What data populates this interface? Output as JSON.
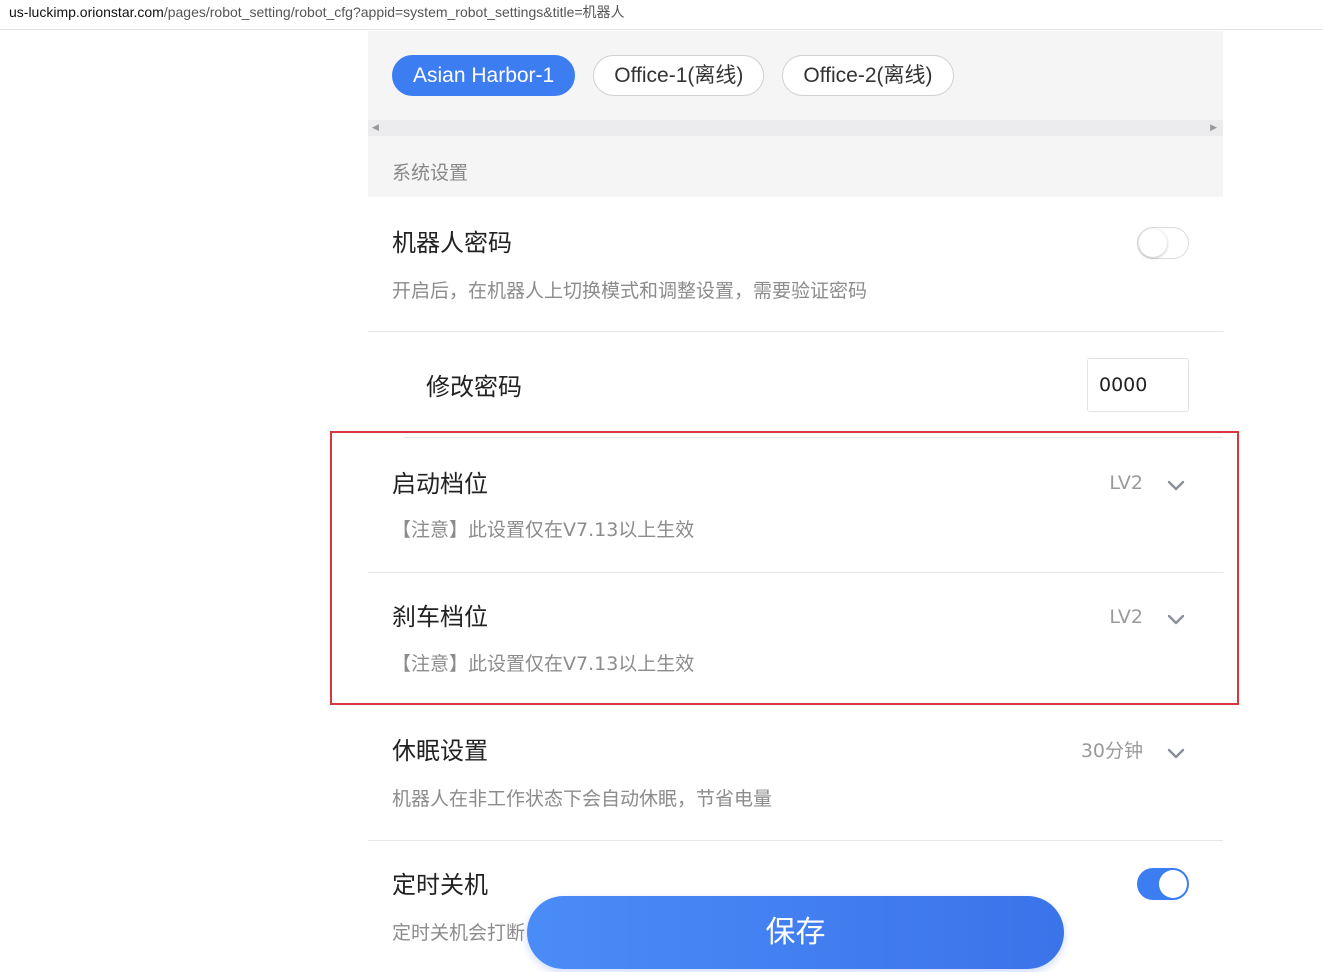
{
  "browser": {
    "url_host": "us-luckimp.orionstar.com",
    "url_path": "/pages/robot_setting/robot_cfg?appid=system_robot_settings&title=机器人"
  },
  "tabs": [
    {
      "label": "Asian Harbor-1",
      "active": true
    },
    {
      "label": "Office-1(离线)",
      "active": false
    },
    {
      "label": "Office-2(离线)",
      "active": false
    }
  ],
  "section_title": "系统设置",
  "settings": {
    "robot_password": {
      "title": "机器人密码",
      "desc": "开启后，在机器人上切换模式和调整设置，需要验证密码",
      "enabled": false
    },
    "change_password": {
      "title": "修改密码",
      "value": "0000"
    },
    "start_level": {
      "title": "启动档位",
      "desc": "【注意】此设置仅在V7.13以上生效",
      "value": "LV2"
    },
    "brake_level": {
      "title": "刹车档位",
      "desc": "【注意】此设置仅在V7.13以上生效",
      "value": "LV2"
    },
    "sleep": {
      "title": "休眠设置",
      "desc": "机器人在非工作状态下会自动休眠，节省电量",
      "value": "30分钟"
    },
    "timed_shutdown": {
      "title": "定时关机",
      "desc": "定时关机会打断",
      "enabled": true
    }
  },
  "save_label": "保存",
  "colors": {
    "accent": "#3d7df2",
    "highlight_border": "#d9363e"
  }
}
